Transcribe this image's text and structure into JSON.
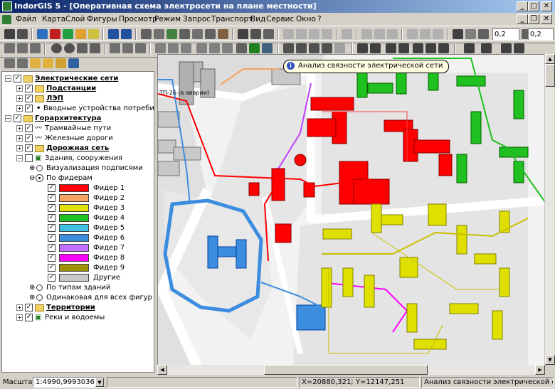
{
  "window": {
    "title": "IndorGIS 5 - [Оперативная схема электросети на плане местности]",
    "min_glyph": "_",
    "max_glyph": "□",
    "close_glyph": "✕",
    "restore_glyph": "❐"
  },
  "menu": [
    "Файл",
    "Карта",
    "Слой",
    "Фигуры",
    "Просмотр",
    "Режим",
    "Запрос",
    "Транспорт",
    "Вид",
    "Сервис",
    "Окно",
    "?"
  ],
  "toolbar": {
    "zoom_value_1": "0,2",
    "zoom_value_2": "0,2"
  },
  "tree": {
    "nodes": [
      {
        "label": "Электрические сети",
        "bold": true,
        "expanded": true
      },
      {
        "label": "Подстанции",
        "bold": true
      },
      {
        "label": "ЛЭП",
        "bold": true
      },
      {
        "label": "Вводные устройства потребителей",
        "bold": false
      },
      {
        "label": "Горархитектура",
        "bold": true,
        "expanded": true
      },
      {
        "label": "Трамвайные пути",
        "bold": false
      },
      {
        "label": "Железные дороги",
        "bold": false
      },
      {
        "label": "Дорожная сеть",
        "bold": true
      },
      {
        "label": "Здания, сооружения",
        "bold": false
      },
      {
        "label": "Визуализация подписями",
        "bold": false
      },
      {
        "label": "По фидерам",
        "bold": false
      },
      {
        "label": "По типам зданий",
        "bold": false
      },
      {
        "label": "Одинаковая для всех фигур",
        "bold": false
      },
      {
        "label": "Территории",
        "bold": true
      },
      {
        "label": "Реки и водоемы",
        "bold": false
      }
    ],
    "feeders": [
      {
        "label": "Фидер 1",
        "color": "#ff0000"
      },
      {
        "label": "Фидер 2",
        "color": "#f4a460"
      },
      {
        "label": "Фидер 3",
        "color": "#e0e000"
      },
      {
        "label": "Фидер 4",
        "color": "#20c020"
      },
      {
        "label": "Фидер 5",
        "color": "#40c0e0"
      },
      {
        "label": "Фидер 6",
        "color": "#3c8ce0"
      },
      {
        "label": "Фидер 7",
        "color": "#c070ff"
      },
      {
        "label": "Фидер 8",
        "color": "#ff00ff"
      },
      {
        "label": "Фидер 9",
        "color": "#a09000"
      },
      {
        "label": "Другие",
        "color": "#c8c8c8"
      }
    ]
  },
  "map": {
    "tooltip": "Анализ связности электрической сети",
    "substation_label": "ТП-26 (в аварии)",
    "colors": {
      "road": "#ffffff",
      "block": "#d0d0d0",
      "feeder1": "#ff0000",
      "feeder3": "#e0e000",
      "feeder4": "#20c020",
      "feeder6": "#3c8ce0",
      "feeder8": "#ff00ff",
      "feeder2": "#f4a460"
    }
  },
  "status": {
    "scale_label": "Масштаб:",
    "scale_value": "1:4990,9993036",
    "coords": "X=20880,321; Y=12147,251",
    "message": "Анализ связности электрической сети"
  }
}
